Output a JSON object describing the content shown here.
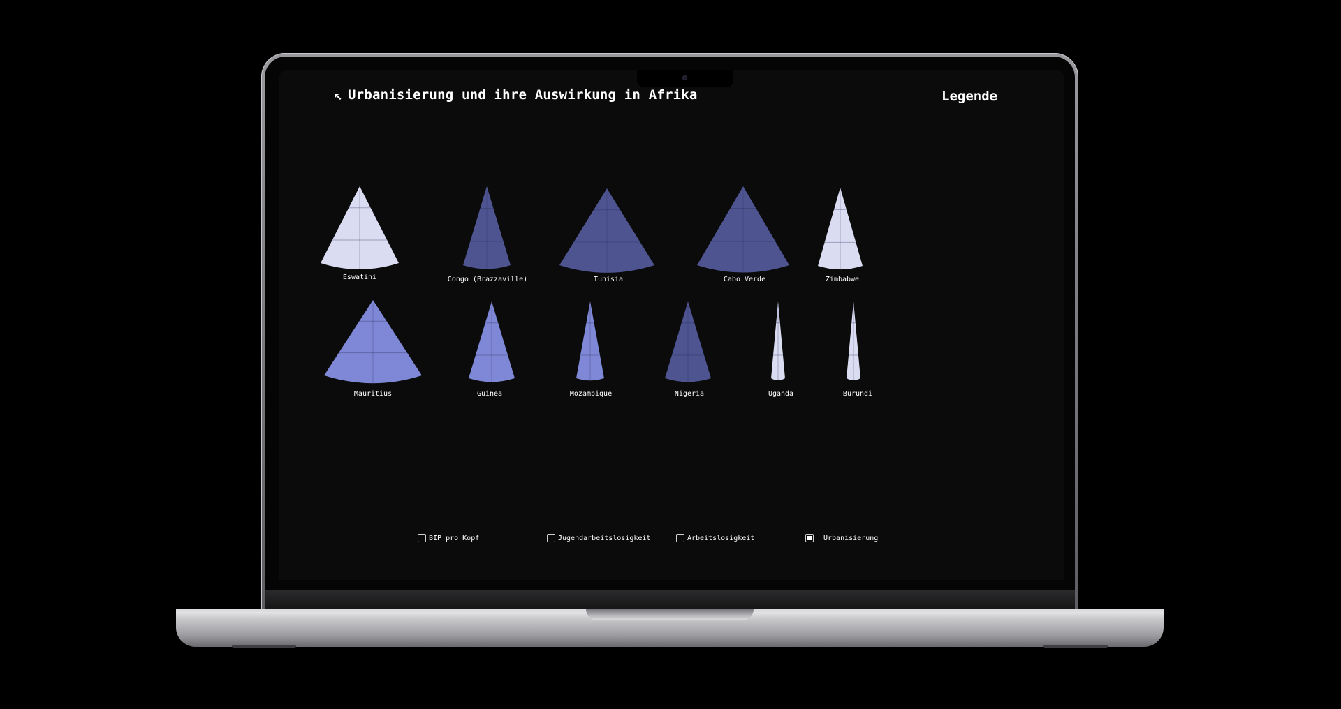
{
  "header": {
    "back_icon": "↖",
    "title": "Urbanisierung und ihre Auswirkung in Afrika",
    "legend_label": "Legende"
  },
  "filters": [
    {
      "label": "BIP pro Kopf",
      "checked": false
    },
    {
      "label": "Jugendarbeitslosigkeit",
      "checked": false
    },
    {
      "label": "Arbeitslosigkeit",
      "checked": false
    },
    {
      "label": "Urbanisierung",
      "checked": true
    }
  ],
  "colors": {
    "light": "#dadcf2",
    "medium": "#7f88d6",
    "dark": "#4d5490",
    "background": "#0b0b0b"
  },
  "countries": [
    {
      "name": "Eswatini",
      "color": "light"
    },
    {
      "name": "Congo (Brazzaville)",
      "color": "dark"
    },
    {
      "name": "Tunisia",
      "color": "dark"
    },
    {
      "name": "Cabo Verde",
      "color": "dark"
    },
    {
      "name": "Zimbabwe",
      "color": "light"
    },
    {
      "name": "Mauritius",
      "color": "medium"
    },
    {
      "name": "Guinea",
      "color": "medium"
    },
    {
      "name": "Mozambique",
      "color": "medium"
    },
    {
      "name": "Nigeria",
      "color": "dark"
    },
    {
      "name": "Uganda",
      "color": "light"
    },
    {
      "name": "Burundi",
      "color": "light"
    }
  ]
}
